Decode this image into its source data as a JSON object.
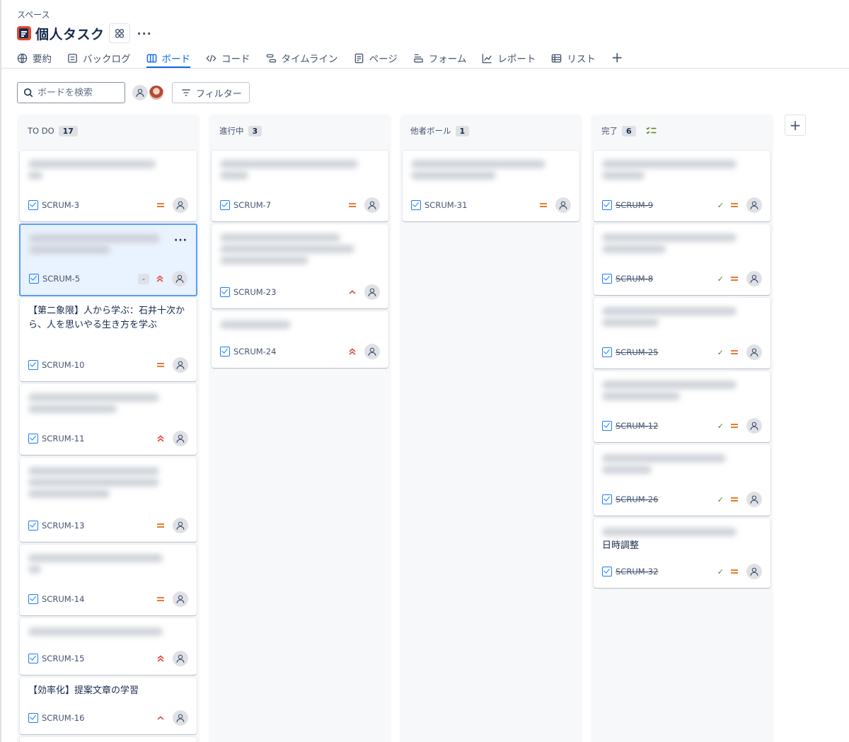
{
  "header": {
    "space_label": "スペース",
    "project_title": "個人タスク"
  },
  "tabs": [
    {
      "label": "要約",
      "icon": "globe-icon"
    },
    {
      "label": "バックログ",
      "icon": "backlog-icon"
    },
    {
      "label": "ボード",
      "icon": "board-icon",
      "active": true
    },
    {
      "label": "コード",
      "icon": "code-icon"
    },
    {
      "label": "タイムライン",
      "icon": "timeline-icon"
    },
    {
      "label": "ページ",
      "icon": "page-icon"
    },
    {
      "label": "フォーム",
      "icon": "form-icon"
    },
    {
      "label": "レポート",
      "icon": "report-icon"
    },
    {
      "label": "リスト",
      "icon": "list-icon"
    }
  ],
  "toolbar": {
    "search_placeholder": "ボードを検索",
    "filter_label": "フィルター"
  },
  "columns": [
    {
      "name": "TO DO",
      "count": "17"
    },
    {
      "name": "進行中",
      "count": "3"
    },
    {
      "name": "他者ボール",
      "count": "1"
    },
    {
      "name": "完了",
      "count": "6"
    }
  ],
  "cards": {
    "scrum3": {
      "key": "SCRUM-3",
      "priority": "medium"
    },
    "scrum5": {
      "key": "SCRUM-5",
      "priority": "high",
      "estimate": "-"
    },
    "scrum10": {
      "key": "SCRUM-10",
      "title": "【第二象限】人から学ぶ：石井十次から、人を思いやる生き方を学ぶ",
      "priority": "medium"
    },
    "scrum11": {
      "key": "SCRUM-11",
      "priority": "high"
    },
    "scrum13": {
      "key": "SCRUM-13",
      "priority": "medium"
    },
    "scrum14": {
      "key": "SCRUM-14",
      "priority": "medium"
    },
    "scrum15": {
      "key": "SCRUM-15",
      "priority": "high"
    },
    "scrum16": {
      "key": "SCRUM-16",
      "title": "【効率化】提案文章の学習",
      "priority": "low-high"
    },
    "scrum7": {
      "key": "SCRUM-7",
      "priority": "medium"
    },
    "scrum23": {
      "key": "SCRUM-23",
      "priority": "low-high"
    },
    "scrum24": {
      "key": "SCRUM-24",
      "priority": "high"
    },
    "scrum31": {
      "key": "SCRUM-31",
      "priority": "medium"
    },
    "scrum9": {
      "key": "SCRUM-9",
      "priority": "medium",
      "done": true
    },
    "scrum8": {
      "key": "SCRUM-8",
      "priority": "medium",
      "done": true
    },
    "scrum25": {
      "key": "SCRUM-25",
      "priority": "medium",
      "done": true
    },
    "scrum12": {
      "key": "SCRUM-12",
      "priority": "medium",
      "done": true
    },
    "scrum26": {
      "key": "SCRUM-26",
      "priority": "medium",
      "done": true
    },
    "scrum32": {
      "key": "SCRUM-32",
      "title_line2": "日時調整",
      "priority": "medium",
      "done": true
    }
  },
  "colors": {
    "accent": "#0c66e4",
    "priority_medium": "#e56910",
    "priority_high": "#e2483d",
    "done_green": "#5b7f24"
  }
}
